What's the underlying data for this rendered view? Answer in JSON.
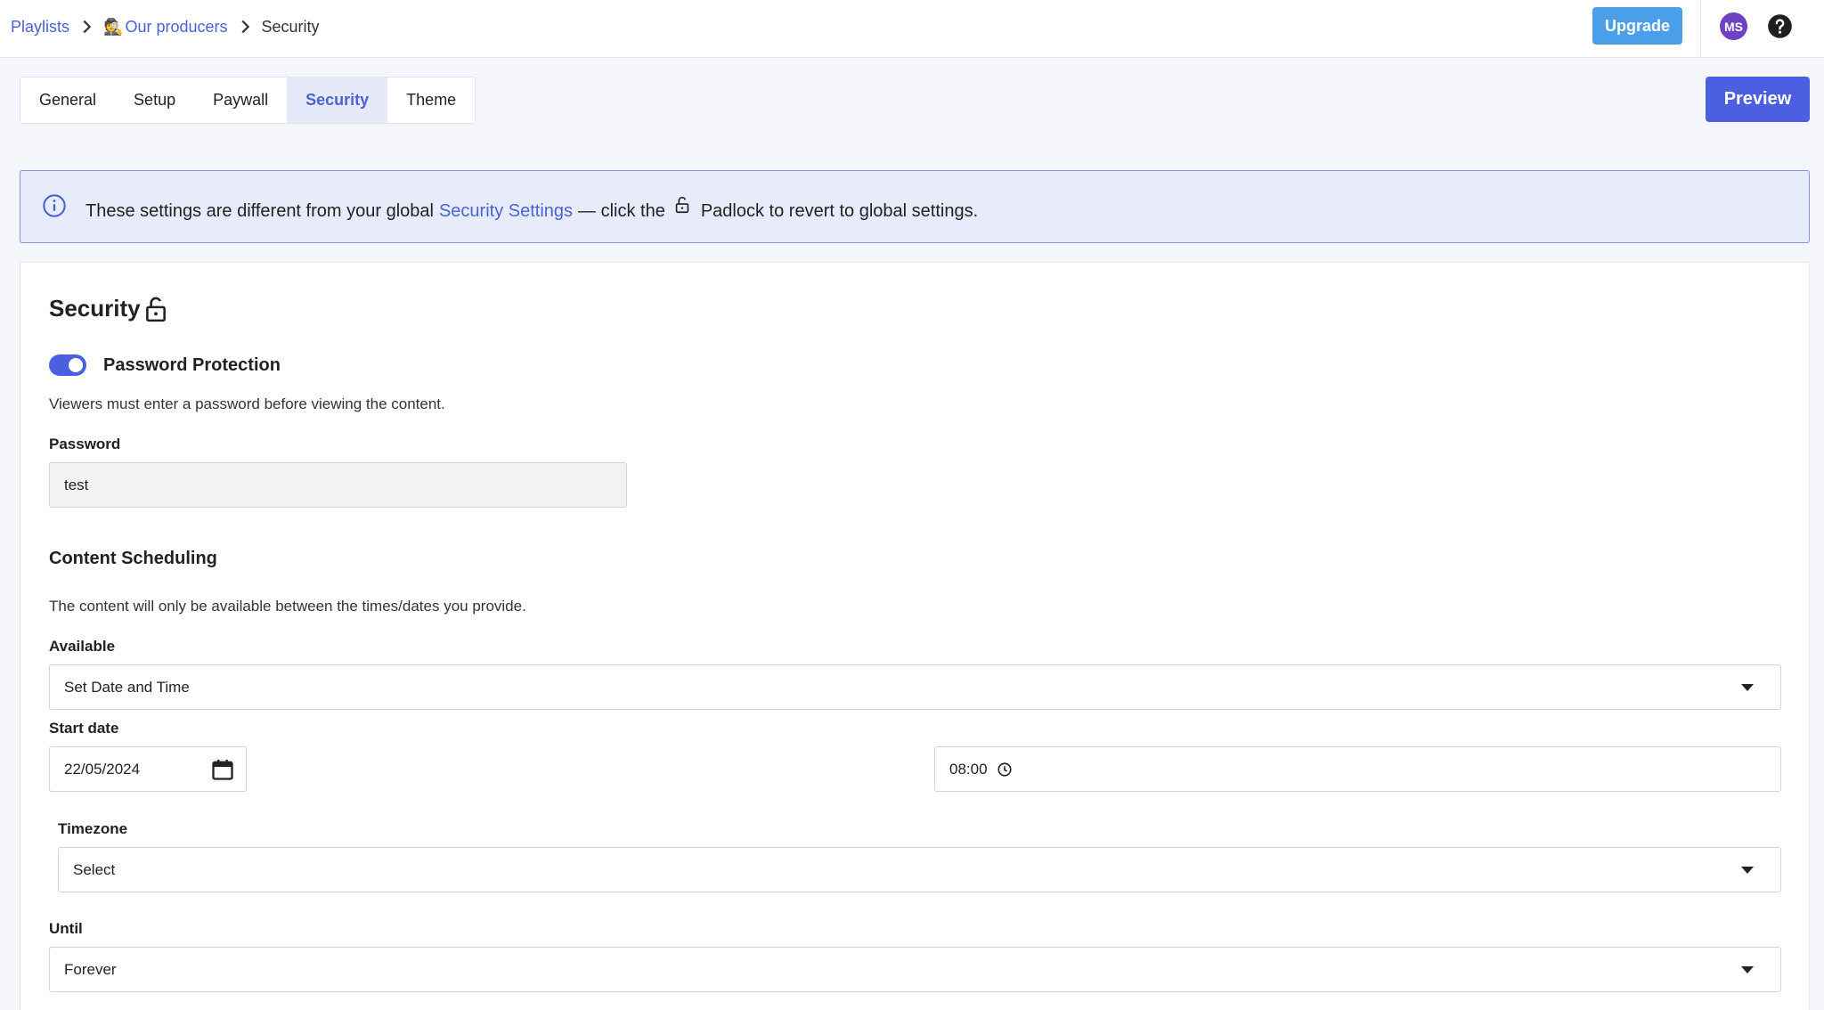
{
  "breadcrumb": {
    "items": [
      "Playlists",
      "Our producers",
      "Security"
    ],
    "emoji": "🕵"
  },
  "header": {
    "upgrade_label": "Upgrade",
    "avatar_initials": "MS"
  },
  "tabs": [
    {
      "label": "General",
      "active": false
    },
    {
      "label": "Setup",
      "active": false
    },
    {
      "label": "Paywall",
      "active": false
    },
    {
      "label": "Security",
      "active": true
    },
    {
      "label": "Theme",
      "active": false
    }
  ],
  "preview_label": "Preview",
  "notice": {
    "text_before": "These settings are different from your global",
    "link": "Security Settings",
    "text_middle": "— click the",
    "text_after": "Padlock to revert to global settings."
  },
  "security": {
    "title": "Security",
    "password_protection": {
      "label": "Password Protection",
      "enabled": true,
      "description": "Viewers must enter a password before viewing the content."
    },
    "password": {
      "label": "Password",
      "value": "test"
    },
    "scheduling": {
      "title": "Content Scheduling",
      "description": "The content will only be available between the times/dates you provide.",
      "available": {
        "label": "Available",
        "value": "Set Date and Time"
      },
      "start_date": {
        "label": "Start date",
        "date": "22/05/2024",
        "time": "08:00"
      },
      "timezone": {
        "label": "Timezone",
        "value": "Select"
      },
      "until": {
        "label": "Until",
        "value": "Forever"
      }
    }
  },
  "colors": {
    "accent": "#4b5fe0",
    "link": "#4a63d4",
    "upgrade": "#4b9ee8",
    "avatar": "#6f42c1"
  }
}
